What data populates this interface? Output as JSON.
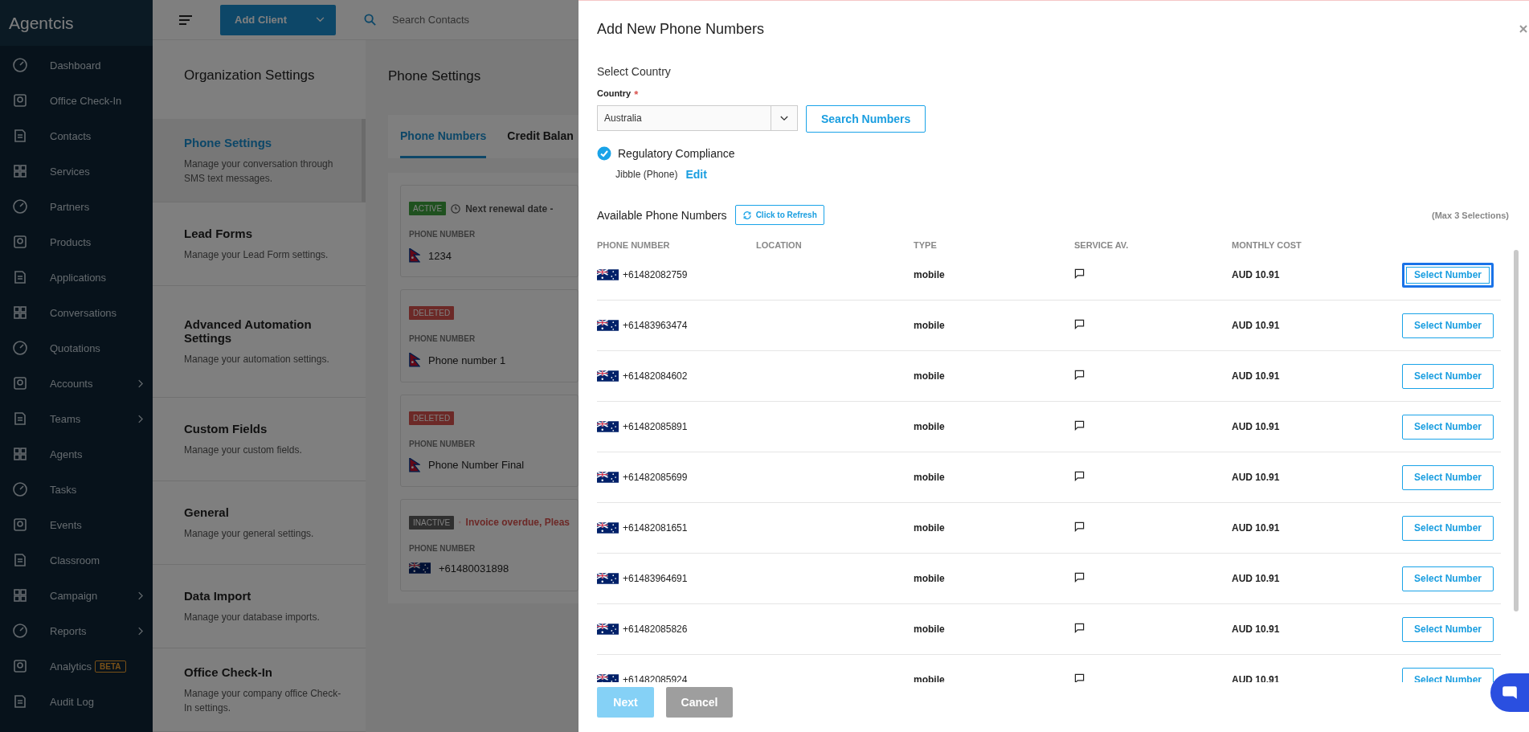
{
  "brand": "Agentcis",
  "sidebar": {
    "items": [
      {
        "label": "Dashboard",
        "has_submenu": false
      },
      {
        "label": "Office Check-In",
        "has_submenu": false
      },
      {
        "label": "Contacts",
        "has_submenu": false
      },
      {
        "label": "Services",
        "has_submenu": false
      },
      {
        "label": "Partners",
        "has_submenu": false
      },
      {
        "label": "Products",
        "has_submenu": false
      },
      {
        "label": "Applications",
        "has_submenu": false
      },
      {
        "label": "Conversations",
        "has_submenu": false
      },
      {
        "label": "Quotations",
        "has_submenu": false
      },
      {
        "label": "Accounts",
        "has_submenu": true
      },
      {
        "label": "Teams",
        "has_submenu": true
      },
      {
        "label": "Agents",
        "has_submenu": false
      },
      {
        "label": "Tasks",
        "has_submenu": false
      },
      {
        "label": "Events",
        "has_submenu": false
      },
      {
        "label": "Classroom",
        "has_submenu": false
      },
      {
        "label": "Campaign",
        "has_submenu": true
      },
      {
        "label": "Reports",
        "has_submenu": true
      },
      {
        "label": "Analytics",
        "has_submenu": false,
        "badge": "BETA"
      },
      {
        "label": "Audit Log",
        "has_submenu": false
      }
    ]
  },
  "topbar": {
    "add_button": "Add Client",
    "search": {
      "placeholder": "Search Contacts"
    }
  },
  "settings_menu": {
    "title": "Organization Settings",
    "items": [
      {
        "title": "Phone Settings",
        "description": "Manage your conversation through SMS text messages.",
        "selected": true
      },
      {
        "title": "Lead Forms",
        "description": "Manage your Lead Form settings.",
        "selected": false
      },
      {
        "title": "Advanced Automation Settings",
        "description": "Manage your automation settings.",
        "selected": false
      },
      {
        "title": "Custom Fields",
        "description": "Manage your custom fields.",
        "selected": false
      },
      {
        "title": "General",
        "description": "Manage your general settings.",
        "selected": false
      },
      {
        "title": "Data Import",
        "description": "Manage your database imports.",
        "selected": false
      },
      {
        "title": "Office Check-In",
        "description": "Manage your company office Check-In settings.",
        "selected": false
      }
    ]
  },
  "phone_settings": {
    "title": "Phone Settings",
    "tabs": [
      {
        "label": "Phone Numbers",
        "selected": true
      },
      {
        "label": "Credit Balan",
        "selected": false
      }
    ],
    "cards": [
      {
        "status": "ACTIVE",
        "kind": "active",
        "note": {
          "text": "Next renewal date -",
          "kind": "info"
        },
        "field_label": "PHONE NUMBER",
        "flag": {
          "kind": "nepal"
        },
        "number": "1234"
      },
      {
        "status": "DELETED",
        "kind": "deleted",
        "field_label": "PHONE NUMBER",
        "flag": {
          "kind": "nepal"
        },
        "number": "Phone number 1"
      },
      {
        "status": "DELETED",
        "kind": "deleted",
        "field_label": "PHONE NUMBER",
        "flag": {
          "kind": "nepal"
        },
        "number": "Phone Number Final"
      },
      {
        "status": "INACTIVE",
        "kind": "inactive",
        "note": {
          "text": "Invoice overdue, Pleas",
          "kind": "warning"
        },
        "field_label": "PHONE NUMBER",
        "flag": {
          "kind": "australia"
        },
        "number": "+61480031898"
      }
    ]
  },
  "dialog": {
    "title": "Add New Phone Numbers",
    "section_title": "Select Country",
    "country": {
      "label": "Country",
      "required_mark": "*",
      "value": "Australia"
    },
    "search_button": "Search Numbers",
    "compliance": {
      "label": "Regulatory Compliance",
      "checked": true,
      "name": "Jibble (Phone)",
      "edit_link": "Edit"
    },
    "available": {
      "title": "Available Phone Numbers",
      "refresh_button": "Click to Refresh",
      "limit_note": "(Max 3 Selections)"
    },
    "table": {
      "columns": [
        "PHONE NUMBER",
        "LOCATION",
        "TYPE",
        "SERVICE AV.",
        "MONTHLY COST"
      ],
      "rows": [
        {
          "flag": {
            "kind": "australia"
          },
          "number": "+61482082759",
          "type": "mobile",
          "cost": "AUD 10.91",
          "action": "Select Number",
          "focused": true
        },
        {
          "flag": {
            "kind": "australia"
          },
          "number": "+61483963474",
          "type": "mobile",
          "cost": "AUD 10.91",
          "action": "Select Number",
          "focused": false
        },
        {
          "flag": {
            "kind": "australia"
          },
          "number": "+61482084602",
          "type": "mobile",
          "cost": "AUD 10.91",
          "action": "Select Number",
          "focused": false
        },
        {
          "flag": {
            "kind": "australia"
          },
          "number": "+61482085891",
          "type": "mobile",
          "cost": "AUD 10.91",
          "action": "Select Number",
          "focused": false
        },
        {
          "flag": {
            "kind": "australia"
          },
          "number": "+61482085699",
          "type": "mobile",
          "cost": "AUD 10.91",
          "action": "Select Number",
          "focused": false
        },
        {
          "flag": {
            "kind": "australia"
          },
          "number": "+61482081651",
          "type": "mobile",
          "cost": "AUD 10.91",
          "action": "Select Number",
          "focused": false
        },
        {
          "flag": {
            "kind": "australia"
          },
          "number": "+61483964691",
          "type": "mobile",
          "cost": "AUD 10.91",
          "action": "Select Number",
          "focused": false
        },
        {
          "flag": {
            "kind": "australia"
          },
          "number": "+61482085826",
          "type": "mobile",
          "cost": "AUD 10.91",
          "action": "Select Number",
          "focused": false
        },
        {
          "flag": {
            "kind": "australia"
          },
          "number": "+61482085924",
          "type": "mobile",
          "cost": "AUD 10.91",
          "action": "Select Number",
          "focused": false
        }
      ]
    },
    "buttons": [
      {
        "label": "Next",
        "kind": "primary",
        "disabled": true
      },
      {
        "label": "Cancel",
        "kind": "secondary",
        "disabled": false
      }
    ]
  }
}
